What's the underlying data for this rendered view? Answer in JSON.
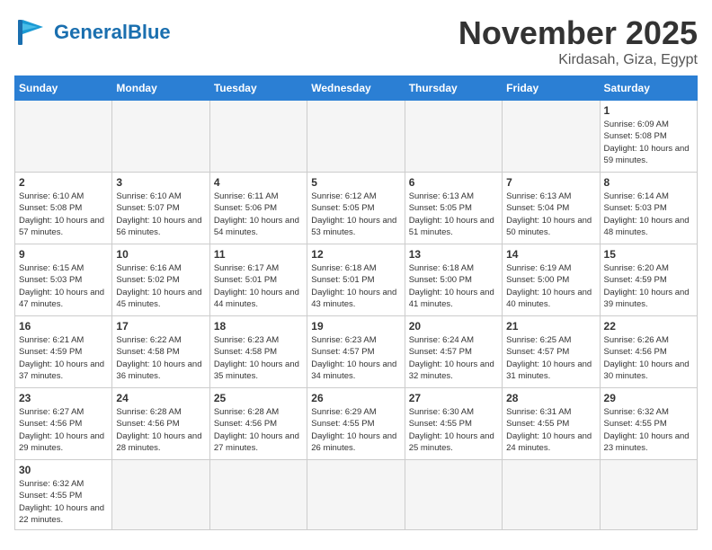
{
  "logo": {
    "general": "General",
    "blue": "Blue"
  },
  "title": "November 2025",
  "location": "Kirdasah, Giza, Egypt",
  "days_of_week": [
    "Sunday",
    "Monday",
    "Tuesday",
    "Wednesday",
    "Thursday",
    "Friday",
    "Saturday"
  ],
  "weeks": [
    [
      {
        "day": "",
        "sunrise": "",
        "sunset": "",
        "daylight": "",
        "empty": true
      },
      {
        "day": "",
        "sunrise": "",
        "sunset": "",
        "daylight": "",
        "empty": true
      },
      {
        "day": "",
        "sunrise": "",
        "sunset": "",
        "daylight": "",
        "empty": true
      },
      {
        "day": "",
        "sunrise": "",
        "sunset": "",
        "daylight": "",
        "empty": true
      },
      {
        "day": "",
        "sunrise": "",
        "sunset": "",
        "daylight": "",
        "empty": true
      },
      {
        "day": "",
        "sunrise": "",
        "sunset": "",
        "daylight": "",
        "empty": true
      },
      {
        "day": "1",
        "sunrise": "Sunrise: 6:09 AM",
        "sunset": "Sunset: 5:08 PM",
        "daylight": "Daylight: 10 hours and 59 minutes.",
        "empty": false
      }
    ],
    [
      {
        "day": "2",
        "sunrise": "Sunrise: 6:10 AM",
        "sunset": "Sunset: 5:08 PM",
        "daylight": "Daylight: 10 hours and 57 minutes.",
        "empty": false
      },
      {
        "day": "3",
        "sunrise": "Sunrise: 6:10 AM",
        "sunset": "Sunset: 5:07 PM",
        "daylight": "Daylight: 10 hours and 56 minutes.",
        "empty": false
      },
      {
        "day": "4",
        "sunrise": "Sunrise: 6:11 AM",
        "sunset": "Sunset: 5:06 PM",
        "daylight": "Daylight: 10 hours and 54 minutes.",
        "empty": false
      },
      {
        "day": "5",
        "sunrise": "Sunrise: 6:12 AM",
        "sunset": "Sunset: 5:05 PM",
        "daylight": "Daylight: 10 hours and 53 minutes.",
        "empty": false
      },
      {
        "day": "6",
        "sunrise": "Sunrise: 6:13 AM",
        "sunset": "Sunset: 5:05 PM",
        "daylight": "Daylight: 10 hours and 51 minutes.",
        "empty": false
      },
      {
        "day": "7",
        "sunrise": "Sunrise: 6:13 AM",
        "sunset": "Sunset: 5:04 PM",
        "daylight": "Daylight: 10 hours and 50 minutes.",
        "empty": false
      },
      {
        "day": "8",
        "sunrise": "Sunrise: 6:14 AM",
        "sunset": "Sunset: 5:03 PM",
        "daylight": "Daylight: 10 hours and 48 minutes.",
        "empty": false
      }
    ],
    [
      {
        "day": "9",
        "sunrise": "Sunrise: 6:15 AM",
        "sunset": "Sunset: 5:03 PM",
        "daylight": "Daylight: 10 hours and 47 minutes.",
        "empty": false
      },
      {
        "day": "10",
        "sunrise": "Sunrise: 6:16 AM",
        "sunset": "Sunset: 5:02 PM",
        "daylight": "Daylight: 10 hours and 45 minutes.",
        "empty": false
      },
      {
        "day": "11",
        "sunrise": "Sunrise: 6:17 AM",
        "sunset": "Sunset: 5:01 PM",
        "daylight": "Daylight: 10 hours and 44 minutes.",
        "empty": false
      },
      {
        "day": "12",
        "sunrise": "Sunrise: 6:18 AM",
        "sunset": "Sunset: 5:01 PM",
        "daylight": "Daylight: 10 hours and 43 minutes.",
        "empty": false
      },
      {
        "day": "13",
        "sunrise": "Sunrise: 6:18 AM",
        "sunset": "Sunset: 5:00 PM",
        "daylight": "Daylight: 10 hours and 41 minutes.",
        "empty": false
      },
      {
        "day": "14",
        "sunrise": "Sunrise: 6:19 AM",
        "sunset": "Sunset: 5:00 PM",
        "daylight": "Daylight: 10 hours and 40 minutes.",
        "empty": false
      },
      {
        "day": "15",
        "sunrise": "Sunrise: 6:20 AM",
        "sunset": "Sunset: 4:59 PM",
        "daylight": "Daylight: 10 hours and 39 minutes.",
        "empty": false
      }
    ],
    [
      {
        "day": "16",
        "sunrise": "Sunrise: 6:21 AM",
        "sunset": "Sunset: 4:59 PM",
        "daylight": "Daylight: 10 hours and 37 minutes.",
        "empty": false
      },
      {
        "day": "17",
        "sunrise": "Sunrise: 6:22 AM",
        "sunset": "Sunset: 4:58 PM",
        "daylight": "Daylight: 10 hours and 36 minutes.",
        "empty": false
      },
      {
        "day": "18",
        "sunrise": "Sunrise: 6:23 AM",
        "sunset": "Sunset: 4:58 PM",
        "daylight": "Daylight: 10 hours and 35 minutes.",
        "empty": false
      },
      {
        "day": "19",
        "sunrise": "Sunrise: 6:23 AM",
        "sunset": "Sunset: 4:57 PM",
        "daylight": "Daylight: 10 hours and 34 minutes.",
        "empty": false
      },
      {
        "day": "20",
        "sunrise": "Sunrise: 6:24 AM",
        "sunset": "Sunset: 4:57 PM",
        "daylight": "Daylight: 10 hours and 32 minutes.",
        "empty": false
      },
      {
        "day": "21",
        "sunrise": "Sunrise: 6:25 AM",
        "sunset": "Sunset: 4:57 PM",
        "daylight": "Daylight: 10 hours and 31 minutes.",
        "empty": false
      },
      {
        "day": "22",
        "sunrise": "Sunrise: 6:26 AM",
        "sunset": "Sunset: 4:56 PM",
        "daylight": "Daylight: 10 hours and 30 minutes.",
        "empty": false
      }
    ],
    [
      {
        "day": "23",
        "sunrise": "Sunrise: 6:27 AM",
        "sunset": "Sunset: 4:56 PM",
        "daylight": "Daylight: 10 hours and 29 minutes.",
        "empty": false
      },
      {
        "day": "24",
        "sunrise": "Sunrise: 6:28 AM",
        "sunset": "Sunset: 4:56 PM",
        "daylight": "Daylight: 10 hours and 28 minutes.",
        "empty": false
      },
      {
        "day": "25",
        "sunrise": "Sunrise: 6:28 AM",
        "sunset": "Sunset: 4:56 PM",
        "daylight": "Daylight: 10 hours and 27 minutes.",
        "empty": false
      },
      {
        "day": "26",
        "sunrise": "Sunrise: 6:29 AM",
        "sunset": "Sunset: 4:55 PM",
        "daylight": "Daylight: 10 hours and 26 minutes.",
        "empty": false
      },
      {
        "day": "27",
        "sunrise": "Sunrise: 6:30 AM",
        "sunset": "Sunset: 4:55 PM",
        "daylight": "Daylight: 10 hours and 25 minutes.",
        "empty": false
      },
      {
        "day": "28",
        "sunrise": "Sunrise: 6:31 AM",
        "sunset": "Sunset: 4:55 PM",
        "daylight": "Daylight: 10 hours and 24 minutes.",
        "empty": false
      },
      {
        "day": "29",
        "sunrise": "Sunrise: 6:32 AM",
        "sunset": "Sunset: 4:55 PM",
        "daylight": "Daylight: 10 hours and 23 minutes.",
        "empty": false
      }
    ],
    [
      {
        "day": "30",
        "sunrise": "Sunrise: 6:32 AM",
        "sunset": "Sunset: 4:55 PM",
        "daylight": "Daylight: 10 hours and 22 minutes.",
        "empty": false
      },
      {
        "day": "",
        "empty": true
      },
      {
        "day": "",
        "empty": true
      },
      {
        "day": "",
        "empty": true
      },
      {
        "day": "",
        "empty": true
      },
      {
        "day": "",
        "empty": true
      },
      {
        "day": "",
        "empty": true
      }
    ]
  ]
}
